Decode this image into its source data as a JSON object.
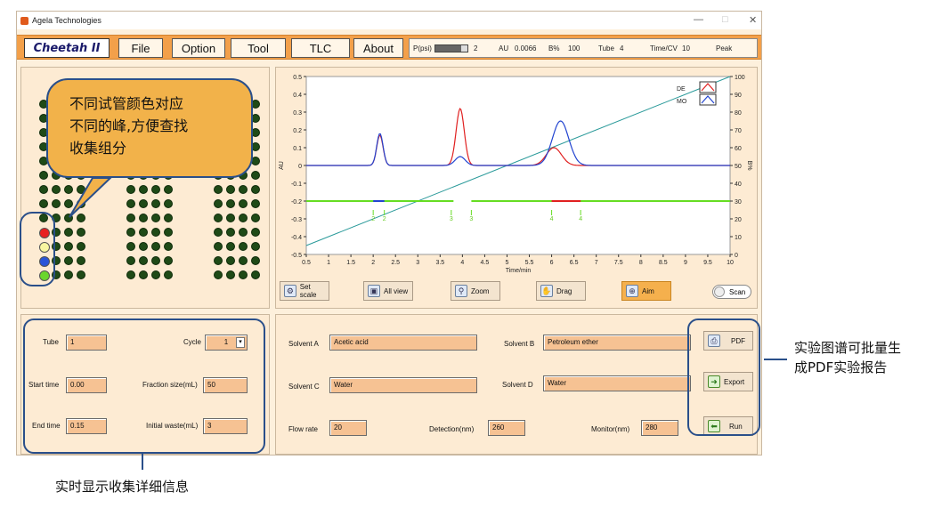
{
  "window": {
    "title": "Agela Technologies",
    "minimize": "—",
    "maximize": "□",
    "close": "✕"
  },
  "menu": {
    "logo": "Cheetah II",
    "file": "File",
    "option": "Option",
    "tool": "Tool",
    "tlc": "TLC",
    "about": "About"
  },
  "status": {
    "p_label": "P(psi)",
    "p_value": "2",
    "p_level": 0.8,
    "au_label": "AU",
    "au_value": "0.0066",
    "b_label": "B%",
    "b_value": "100",
    "tube_label": "Tube",
    "tube_value": "4",
    "time_label": "Time/CV",
    "time_value": "10",
    "peak_label": "Peak"
  },
  "callout": {
    "line1": "不同试管颜色对应",
    "line2": "不同的峰,方便查找",
    "line3": "收集组分"
  },
  "tube_colors": [
    "#e82020",
    "#f8f5a0",
    "#2a55d8",
    "#6ad62c"
  ],
  "chart_data": {
    "type": "line",
    "xlabel": "Time/min",
    "ylabel_left": "AU",
    "ylabel_right": "B%",
    "xlim": [
      0.5,
      10
    ],
    "ylim_left": [
      -0.5,
      0.5
    ],
    "ylim_right": [
      0,
      100
    ],
    "xticks": [
      "0.5",
      "1",
      "1.5",
      "2",
      "2.5",
      "3",
      "3.5",
      "4",
      "4.5",
      "5",
      "5.5",
      "6",
      "6.5",
      "7",
      "7.5",
      "8",
      "8.5",
      "9",
      "9.5",
      "10"
    ],
    "yticks_left": [
      "0.5",
      "0.4",
      "0.3",
      "0.2",
      "0.1",
      "0",
      "-0.1",
      "-0.2",
      "-0.3",
      "-0.4",
      "-0.5"
    ],
    "yticks_right": [
      "100",
      "90",
      "80",
      "70",
      "60",
      "50",
      "40",
      "30",
      "20",
      "10",
      "0"
    ],
    "legend": [
      "DE",
      "MO"
    ],
    "legend_position": "top-right",
    "series": [
      {
        "name": "DE",
        "color": "#e02020",
        "peaks": [
          [
            2.15,
            0.17,
            0.1
          ],
          [
            3.95,
            0.32,
            0.13
          ],
          [
            6.05,
            0.1,
            0.24
          ]
        ]
      },
      {
        "name": "MO",
        "color": "#2244d0",
        "peaks": [
          [
            2.15,
            0.18,
            0.1
          ],
          [
            3.95,
            0.05,
            0.16
          ],
          [
            6.2,
            0.25,
            0.26
          ]
        ]
      },
      {
        "name": "",
        "color": "#2a9a9a",
        "points": [
          [
            0.5,
            5
          ],
          [
            10,
            100
          ]
        ]
      }
    ],
    "fraction_line": {
      "color": "#66dd22",
      "y": -0.2,
      "segments": [
        [
          0.5,
          3.8
        ],
        [
          4.2,
          10
        ]
      ],
      "marks": [
        {
          "x": 2.0,
          "label": "2",
          "color": "#2244d0"
        },
        {
          "x": 2.25,
          "label": "2",
          "color": "#2244d0"
        },
        {
          "x": 3.75,
          "label": "3",
          "color": "#66dd22"
        },
        {
          "x": 4.2,
          "label": "3",
          "color": "#66dd22"
        },
        {
          "x": 6.0,
          "label": "4",
          "color": "#e02020"
        },
        {
          "x": 6.65,
          "label": "4",
          "color": "#e02020"
        }
      ]
    }
  },
  "chart_tools": {
    "set_scale": "Set scale",
    "all_view": "All view",
    "zoom": "Zoom",
    "drag": "Drag",
    "aim": "Aim",
    "scan": "Scan"
  },
  "collect": {
    "tube_label": "Tube",
    "tube_value": "1",
    "cycle_label": "Cycle",
    "cycle_value": "1",
    "start_label": "Start time",
    "start_value": "0.00",
    "fraction_label": "Fraction size(mL)",
    "fraction_value": "50",
    "end_label": "End time",
    "end_value": "0.15",
    "waste_label": "Initial waste(mL)",
    "waste_value": "3"
  },
  "solvents": {
    "a_label": "Solvent A",
    "a_value": "Acetic acid",
    "b_label": "Solvent B",
    "b_value": "Petroleum ether",
    "c_label": "Solvent C",
    "c_value": "Water",
    "d_label": "Solvent D",
    "d_value": "Water",
    "flow_label": "Flow rate",
    "flow_value": "20",
    "det_label": "Detection(nm)",
    "det_value": "260",
    "mon_label": "Monitor(nm)",
    "mon_value": "280"
  },
  "actions": {
    "pdf": "PDF",
    "export": "Export",
    "run": "Run"
  },
  "annotations": {
    "right1": "实验图谱可批量生",
    "right2": "成PDF实验报告",
    "bottom": "实时显示收集详细信息"
  }
}
